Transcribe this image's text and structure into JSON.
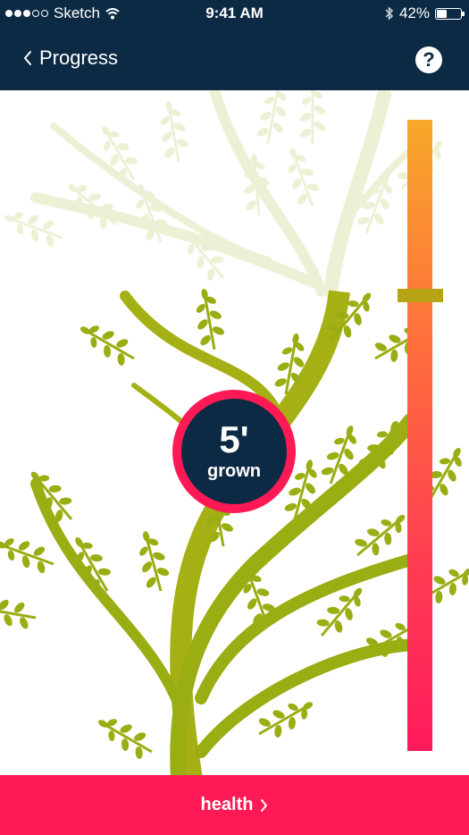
{
  "status_bar": {
    "carrier": "Sketch",
    "time": "9:41 AM",
    "battery": "42%",
    "battery_level": 0.42,
    "signal_bars_filled": 3,
    "signal_bars_total": 5
  },
  "nav": {
    "back_label": "Progress",
    "help_icon": "?"
  },
  "progress": {
    "value": "5'",
    "label": "grown",
    "gauge_level": 0.72
  },
  "footer": {
    "label": "health",
    "chevron": "›"
  },
  "colors": {
    "nav_bg": "#0d2a45",
    "accent": "#ff1a55",
    "tree_green": "#9aad12",
    "tree_faded": "#eef0d6",
    "gauge_top": "#f7a82a",
    "gauge_bottom": "#ff1a5c",
    "marker": "#b6a414"
  }
}
